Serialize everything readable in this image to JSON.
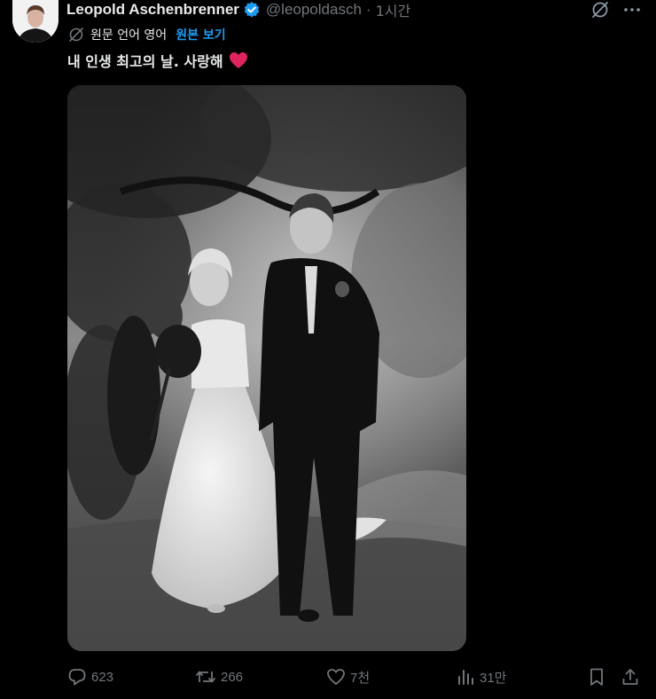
{
  "tweet": {
    "display_name": "Leopold Aschenbrenner",
    "handle": "@leopoldasch",
    "separator": "·",
    "time": "1시간",
    "translate_label": "원문 언어 영어",
    "translate_link": "원본 보기",
    "text": "내 인생 최고의 날. 사랑해",
    "text_emoji": "red-heart-emoji"
  },
  "actions": {
    "replies": "623",
    "reposts": "266",
    "likes": "7천",
    "views": "31만"
  },
  "colors": {
    "background": "#000000",
    "text": "#e7e9ea",
    "muted": "#71767b",
    "link": "#1d9bf0",
    "verified": "#1d9bf0",
    "heart": "#e0245e"
  },
  "icons": {
    "top": [
      "grok-icon",
      "more-icon"
    ],
    "actions": [
      "reply-icon",
      "repost-icon",
      "like-icon",
      "views-icon",
      "bookmark-icon",
      "share-icon"
    ]
  }
}
